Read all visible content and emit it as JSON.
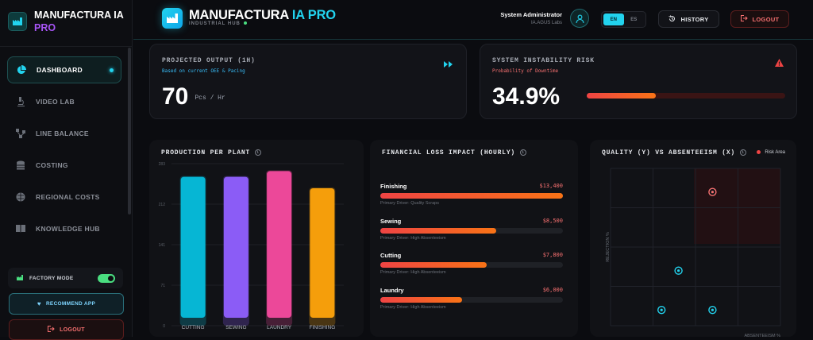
{
  "sidebar": {
    "brand": "MANUFACTURA IA",
    "brand_pro": "PRO",
    "items": [
      {
        "label": "DASHBOARD",
        "icon": "pie-chart-icon",
        "active": true
      },
      {
        "label": "VIDEO LAB",
        "icon": "microscope-icon"
      },
      {
        "label": "LINE BALANCE",
        "icon": "network-icon"
      },
      {
        "label": "COSTING",
        "icon": "coins-icon"
      },
      {
        "label": "REGIONAL COSTS",
        "icon": "globe-icon"
      },
      {
        "label": "KNOWLEDGE HUB",
        "icon": "book-icon"
      }
    ],
    "factory_mode": "FACTORY MODE",
    "recommend": "RECOMMEND APP",
    "logout": "LOGOUT"
  },
  "header": {
    "title": "MANUFACTURA",
    "title_pro": "IA PRO",
    "subtitle": "INDUSTRIAL HUB",
    "user_name": "System Administrator",
    "user_org": "IA.AGUS Labs",
    "lang_en": "EN",
    "lang_es": "ES",
    "history": "HISTORY",
    "logout": "LOGOUT"
  },
  "kpi_output": {
    "title": "PROJECTED OUTPUT (1H)",
    "subtitle": "Based on current OEE & Pacing",
    "value": "70",
    "unit": "Pcs / Hr"
  },
  "kpi_risk": {
    "title": "SYSTEM INSTABILITY RISK",
    "subtitle": "Probability of Downtime",
    "value": "34.9%",
    "percent": 34.9
  },
  "production": {
    "title": "PRODUCTION PER PLANT",
    "yticks": [
      "283",
      "212",
      "141",
      "71",
      "0"
    ],
    "colors": [
      "#06b6d4",
      "#8b5cf6",
      "#ec4899",
      "#f59e0b"
    ]
  },
  "losses": {
    "title": "FINANCIAL LOSS IMPACT (HOURLY)",
    "rows": [
      {
        "name": "Finishing",
        "value": "$13,400",
        "driver": "Primary Driver: Quality Scraps",
        "ratio": 1.0
      },
      {
        "name": "Sewing",
        "value": "$8,500",
        "driver": "Primary Driver: High Absenteeism",
        "ratio": 0.634
      },
      {
        "name": "Cutting",
        "value": "$7,800",
        "driver": "Primary Driver: High Absenteeism",
        "ratio": 0.582
      },
      {
        "name": "Laundry",
        "value": "$6,000",
        "driver": "Primary Driver: High Absenteeism",
        "ratio": 0.448
      }
    ]
  },
  "quality": {
    "title": "QUALITY (Y) VS ABSENTEEISM (X)",
    "legend": "Risk Area",
    "ylabel": "REJECTION %",
    "xlabel": "ABSENTEEISM %"
  },
  "chart_data": [
    {
      "type": "bar",
      "title": "PRODUCTION PER PLANT",
      "categories": [
        "CUTTING",
        "SEWING",
        "LAUNDRY",
        "FINISHING"
      ],
      "values": [
        260,
        260,
        270,
        240
      ],
      "ylim": [
        0,
        283
      ],
      "ytick_labels": [
        "0",
        "71",
        "141",
        "212",
        "283"
      ],
      "grid": true
    },
    {
      "type": "bar",
      "title": "FINANCIAL LOSS IMPACT (HOURLY)",
      "categories": [
        "Finishing",
        "Sewing",
        "Cutting",
        "Laundry"
      ],
      "values": [
        13400,
        8500,
        7800,
        6000
      ],
      "orientation": "horizontal"
    },
    {
      "type": "scatter",
      "title": "QUALITY (Y) VS ABSENTEEISM (X)",
      "xlabel": "ABSENTEEISM %",
      "ylabel": "REJECTION %",
      "points": [
        {
          "x": 0.6,
          "y": 0.85
        },
        {
          "x": 0.4,
          "y": 0.35
        },
        {
          "x": 0.3,
          "y": 0.1
        },
        {
          "x": 0.6,
          "y": 0.1
        }
      ],
      "legend": [
        "Risk Area"
      ],
      "legend_position": "top-right",
      "grid": true
    }
  ]
}
